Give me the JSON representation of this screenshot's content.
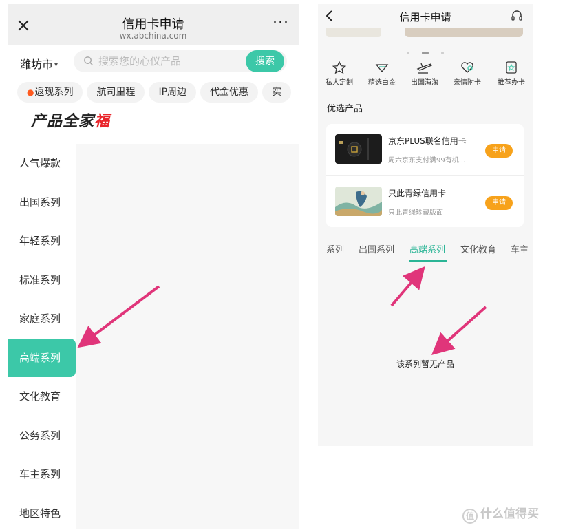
{
  "left_screen": {
    "nav": {
      "title": "信用卡申请",
      "url": "wx.abchina.com",
      "close_icon": "close-icon",
      "more": "···"
    },
    "city": {
      "label": "潍坊市",
      "caret": "▾"
    },
    "search": {
      "placeholder": "搜索您的心仪产品",
      "button": "搜索"
    },
    "chips": [
      {
        "label": "返现系列",
        "icon": "flame-icon"
      },
      {
        "label": "航司里程"
      },
      {
        "label": "IP周边"
      },
      {
        "label": "代金优惠"
      },
      {
        "label": "实"
      }
    ],
    "brand": {
      "text": "产品全家",
      "accent": "福"
    },
    "sidebar": {
      "items": [
        {
          "label": "人气爆款"
        },
        {
          "label": "出国系列"
        },
        {
          "label": "年轻系列"
        },
        {
          "label": "标准系列"
        },
        {
          "label": "家庭系列"
        },
        {
          "label": "高端系列",
          "active": true
        },
        {
          "label": "文化教育"
        },
        {
          "label": "公务系列"
        },
        {
          "label": "车主系列"
        },
        {
          "label": "地区特色"
        }
      ]
    }
  },
  "right_screen": {
    "header": {
      "title": "信用卡申请",
      "back_icon": "back-chevron-icon",
      "service_icon": "headset-icon"
    },
    "carousel": {
      "dots": 3,
      "active_index": 1
    },
    "quick_icons": [
      {
        "label": "私人定制",
        "icon": "star-icon"
      },
      {
        "label": "精选白金",
        "icon": "diamond-icon"
      },
      {
        "label": "出国海淘",
        "icon": "plane-icon"
      },
      {
        "label": "亲情附卡",
        "icon": "heart-icon"
      },
      {
        "label": "推荐办卡",
        "icon": "badge-icon"
      }
    ],
    "section_title": "优选产品",
    "products": [
      {
        "name": "京东PLUS联名信用卡",
        "desc": "周六京东支付满99有机...",
        "apply": "申请"
      },
      {
        "name": "只此青绿信用卡",
        "desc": "只此青绿珍藏版面",
        "apply": "申请"
      }
    ],
    "tabs": [
      {
        "label": "系列"
      },
      {
        "label": "出国系列"
      },
      {
        "label": "高端系列",
        "active": true
      },
      {
        "label": "文化教育"
      },
      {
        "label": "车主"
      }
    ],
    "empty_message": "该系列暂无产品"
  },
  "watermark": {
    "badge": "值",
    "text": "什么值得买"
  },
  "colors": {
    "accent": "#3cc8a8",
    "tab_active": "#2bb596",
    "apply": "#f7a21b",
    "arrow": "#e0357a"
  }
}
